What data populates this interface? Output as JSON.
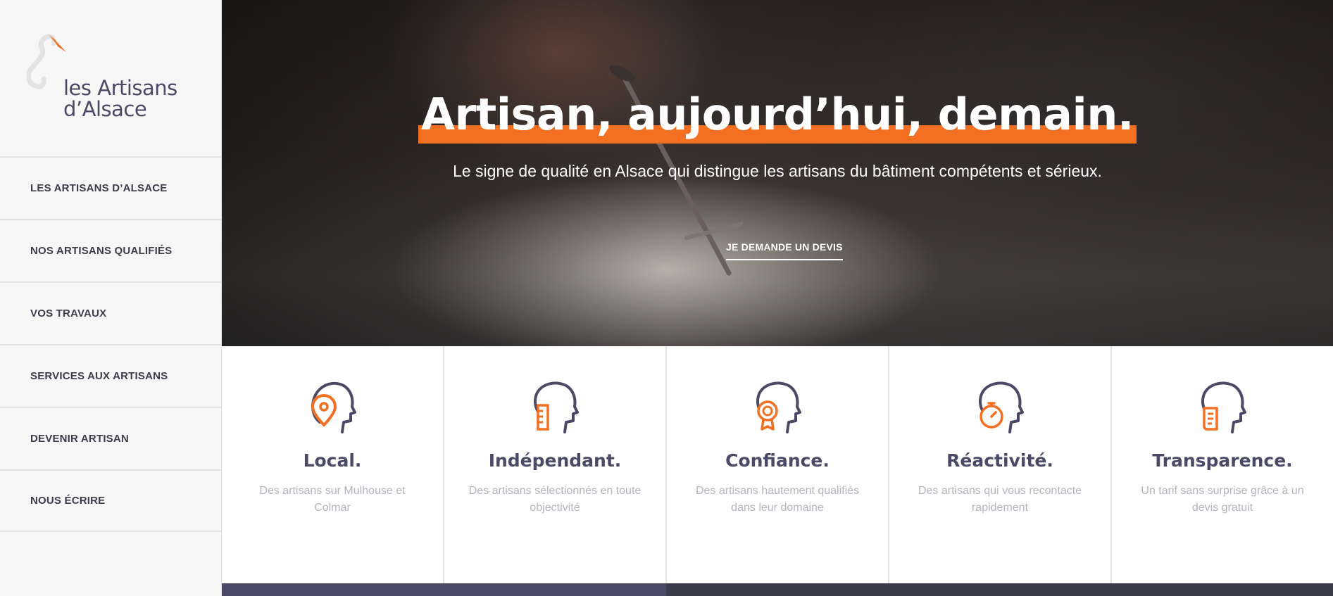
{
  "brand": {
    "line1": "les Artisans",
    "line2": "d’Alsace",
    "colors": {
      "accent": "#f36f21",
      "primary": "#4a4a66"
    }
  },
  "nav": {
    "items": [
      {
        "label": "LES ARTISANS D’ALSACE"
      },
      {
        "label": "NOS ARTISANS QUALIFIÉS"
      },
      {
        "label": "VOS TRAVAUX"
      },
      {
        "label": "SERVICES AUX ARTISANS"
      },
      {
        "label": "DEVENIR ARTISAN"
      },
      {
        "label": "NOUS ÉCRIRE"
      }
    ]
  },
  "hero": {
    "title": "Artisan, aujourd’hui, demain.",
    "subtitle": "Le signe de qualité en Alsace qui distingue les artisans du bâtiment compétents et sérieux.",
    "cta": "JE DEMANDE UN DEVIS"
  },
  "features": [
    {
      "icon": "location-pin-head-icon",
      "title": "Local.",
      "desc": "Des artisans sur Mulhouse et Colmar"
    },
    {
      "icon": "ruler-head-icon",
      "title": "Indépendant.",
      "desc": "Des artisans sélectionnés en toute objectivité"
    },
    {
      "icon": "award-badge-head-icon",
      "title": "Confiance.",
      "desc": "Des artisans hautement qualifiés dans leur domaine"
    },
    {
      "icon": "stopwatch-head-icon",
      "title": "Réactivité.",
      "desc": "Des artisans qui vous recontacte rapidement"
    },
    {
      "icon": "document-head-icon",
      "title": "Transparence.",
      "desc": "Un tarif sans surprise grâce à un devis gratuit"
    }
  ]
}
